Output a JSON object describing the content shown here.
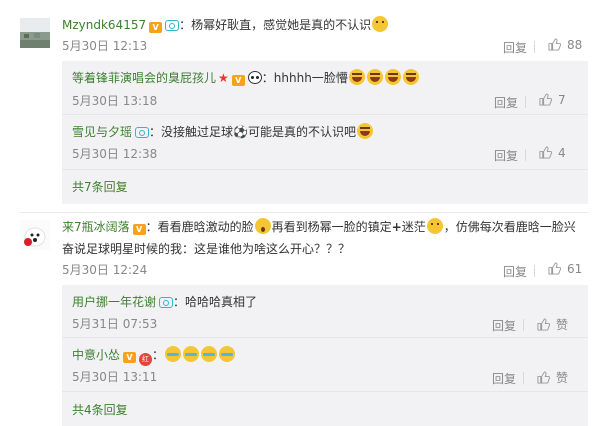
{
  "comments": [
    {
      "user": "Mzyndk64157",
      "text": "：杨幂好耿直，感觉她是真的不认识",
      "time": "5月30日 12:13",
      "reply": "回复",
      "likes": "88"
    },
    {
      "user": "来7瓶冰阔落",
      "text_1": "：看看鹿晗激动的脸",
      "text_2": "再看到杨幂一脸的镇定",
      "text_3": "迷茫",
      "text_4": "，仿佛每次看鹿晗一脸兴",
      "text_line2": "奋说足球明星时候的我：这是谁他为啥这么开心？？？",
      "time": "5月30日 12:24",
      "reply": "回复",
      "likes": "61"
    }
  ],
  "subreplies_1": [
    {
      "user": "等着锋菲演唱会的臭屁孩儿",
      "text": "：hhhhh一脸懵",
      "time": "5月30日 13:18",
      "reply": "回复",
      "likes": "7"
    },
    {
      "user": "雪见与夕瑶",
      "text_1": "：没接触过足球",
      "text_2": "可能是真的不认识吧",
      "time": "5月30日 12:38",
      "reply": "回复",
      "likes": "4"
    }
  ],
  "more_1": "共7条回复",
  "subreplies_2": [
    {
      "user": "用户挪一年花谢",
      "text": "：哈哈哈真相了",
      "time": "5月31日 07:53",
      "reply": "回复",
      "likes": "赞"
    },
    {
      "user": "中意小怂",
      "text": "：",
      "time": "5月30日 13:11",
      "reply": "回复",
      "likes": "赞"
    }
  ],
  "more_2": "共4条回复",
  "icons": {
    "vip": "vip-badge-icon",
    "camera": "camera-badge-icon",
    "thumb": "thumbs-up-icon",
    "panda": "panda-icon",
    "star": "star-icon"
  },
  "colors": {
    "username": "#3d7f2f",
    "sub_bg": "#f2f2f5",
    "meta": "#888888"
  }
}
